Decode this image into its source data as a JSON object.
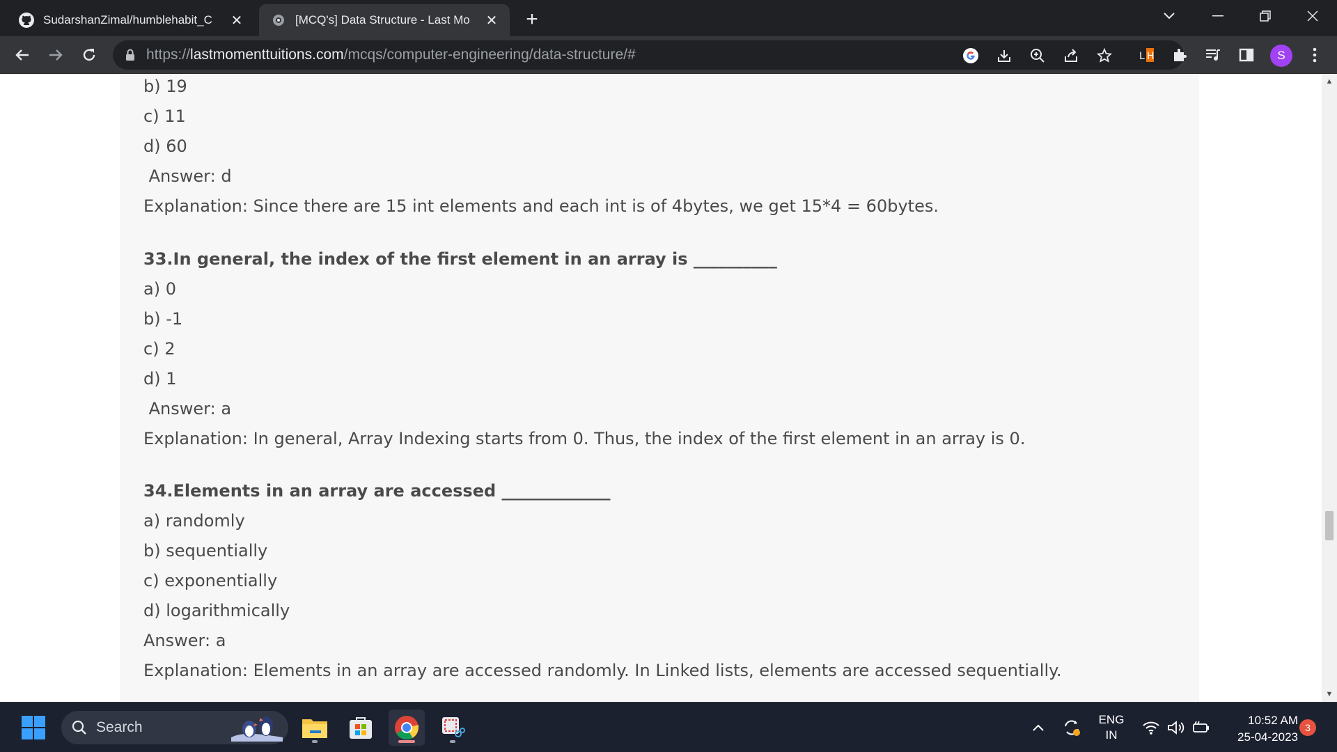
{
  "browser": {
    "tabs": [
      {
        "title": "SudarshanZimal/humblehabit_C",
        "active": false,
        "favicon": "github-icon"
      },
      {
        "title": "[MCQ's] Data Structure - Last Mo",
        "active": true,
        "favicon": "site-icon"
      }
    ],
    "url_scheme": "https://",
    "url_host": "lastmomenttuitions.com",
    "url_path": "/mcqs/computer-engineering/data-structure/#",
    "profile_initial": "S",
    "extension_label": "LH"
  },
  "content": {
    "lines": [
      {
        "text": "b) 19",
        "kind": "option"
      },
      {
        "text": "c) 11",
        "kind": "option"
      },
      {
        "text": "d) 60",
        "kind": "option"
      },
      {
        "text": " Answer: d",
        "kind": "answer"
      },
      {
        "text": "Explanation: Since there are 15 int elements and each int is of 4bytes, we get 15*4 = 60bytes.",
        "kind": "explanation"
      },
      {
        "text": "33.In general, the index of the first element in an array is __________",
        "kind": "question"
      },
      {
        "text": "a) 0",
        "kind": "option"
      },
      {
        "text": "b) -1",
        "kind": "option"
      },
      {
        "text": "c) 2",
        "kind": "option"
      },
      {
        "text": "d) 1",
        "kind": "option"
      },
      {
        "text": " Answer: a",
        "kind": "answer"
      },
      {
        "text": "Explanation: In general, Array Indexing starts from 0. Thus, the index of the first element in an array is 0.",
        "kind": "explanation"
      },
      {
        "text": "34.Elements in an array are accessed _____________",
        "kind": "question"
      },
      {
        "text": "a) randomly",
        "kind": "option"
      },
      {
        "text": "b) sequentially",
        "kind": "option"
      },
      {
        "text": "c) exponentially",
        "kind": "option"
      },
      {
        "text": "d) logarithmically",
        "kind": "option"
      },
      {
        "text": "Answer: a",
        "kind": "answer"
      },
      {
        "text": "Explanation: Elements in an array are accessed randomly. In Linked lists, elements are accessed sequentially.",
        "kind": "explanation"
      }
    ]
  },
  "taskbar": {
    "search_label": "Search",
    "lang_line1": "ENG",
    "lang_line2": "IN",
    "time": "10:52 AM",
    "date": "25-04-2023",
    "notification_count": "3"
  },
  "colors": {
    "chrome_dark": "#202124",
    "chrome_toolbar": "#35363a",
    "article_bg": "#f7f7f7",
    "text": "#4a4a4a",
    "avatar": "#a142f4",
    "taskbar": "#1c2130"
  }
}
